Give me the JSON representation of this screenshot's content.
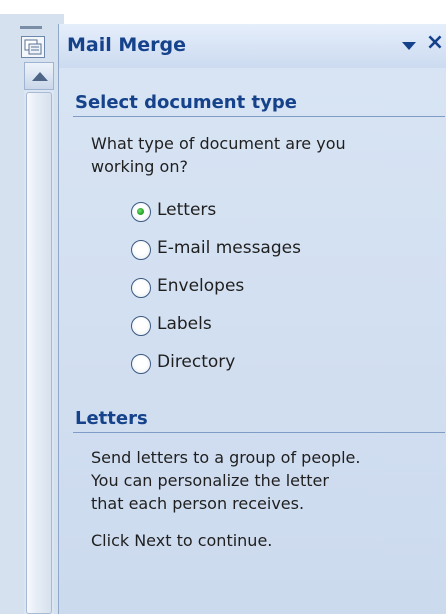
{
  "pane": {
    "title": "Mail Merge",
    "icons": {
      "pane_icon": "task-pane-icon",
      "dropdown": "chevron-down-icon",
      "close": "close-icon"
    },
    "close_glyph": "×"
  },
  "select_section": {
    "title": "Select document type",
    "question_line1": "What type of document are you",
    "question_line2": "working on?",
    "selected": "Letters",
    "options": [
      "Letters",
      "E-mail messages",
      "Envelopes",
      "Labels",
      "Directory"
    ]
  },
  "letters_section": {
    "title": "Letters",
    "desc_line1": "Send letters to a group of people.",
    "desc_line2": "You can personalize the letter",
    "desc_line3": "that each person receives.",
    "next_hint": "Click Next to continue."
  },
  "colors": {
    "accent": "#15428b",
    "pane_bg": "#d3e0f2",
    "radio_selected": "#1f9a1f"
  }
}
